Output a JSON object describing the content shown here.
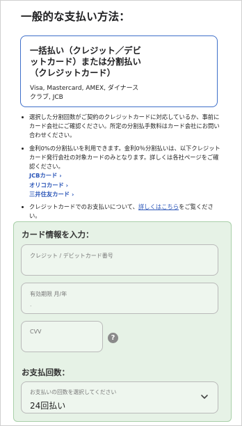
{
  "title": "一般的な支払い方法：",
  "option": {
    "title": "一括払い（クレジット／デビットカード）または分割払い（クレジットカード）",
    "brands": "Visa, Mastercard, AMEX, ダイナースクラブ, JCB"
  },
  "notes": {
    "note1": "選択した分割回数がご契約のクレジットカードに対応しているか、事前にカード会社にご確認ください。所定の分割払手数料はカード会社にお問い合わせください。",
    "note2": "金利0%の分割払いを利用できます。金利0％分割払いは、以下クレジットカード発行会社の対象カードのみとなります。詳しくは各社ページをご確認ください。",
    "issuer_links": [
      "JCBカード ›",
      "オリコカード ›",
      "三井住友カード ›"
    ],
    "note3_prefix": "クレジットカードでのお支払いについて、",
    "note3_link": "詳しくはこちら",
    "note3_suffix": "をご覧ください。"
  },
  "card_form": {
    "title": "カード情報を入力：",
    "card_number_label": "クレジット / デビットカード番号",
    "expiry_label": "有効期限 月/年",
    "expiry_value": ".",
    "cvv_label": "CVV",
    "help_glyph": "?",
    "installments_title": "お支払回数：",
    "installments_label": "お支払いの回数を選択してください",
    "installments_value": "24回払い"
  }
}
